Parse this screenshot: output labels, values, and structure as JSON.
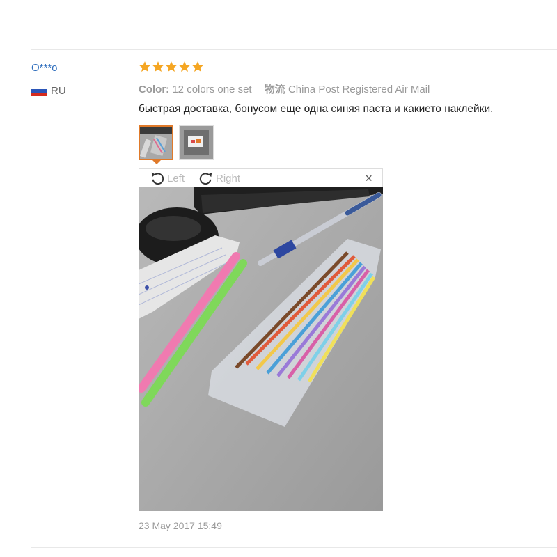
{
  "review": {
    "user": "O***o",
    "country_code": "RU",
    "rating": 5,
    "color_label": "Color:",
    "color_value": "12 colors one set",
    "shipping_label": "物流",
    "shipping_value": "China Post Registered Air Mail",
    "text": "быстрая доставка, бонусом еще одна синяя паста и какието наклейки.",
    "date": "23 May 2017 15:49"
  },
  "viewer": {
    "rotate_left_label": "Left",
    "rotate_right_label": "Right",
    "close_label": "×"
  },
  "colors": {
    "star": "#f5a623",
    "username": "#2f6ebd",
    "active_thumb_border": "#e07a2a"
  },
  "icons": [
    "star-icon",
    "flag-ru-icon",
    "rotate-left-icon",
    "rotate-right-icon",
    "close-icon"
  ]
}
